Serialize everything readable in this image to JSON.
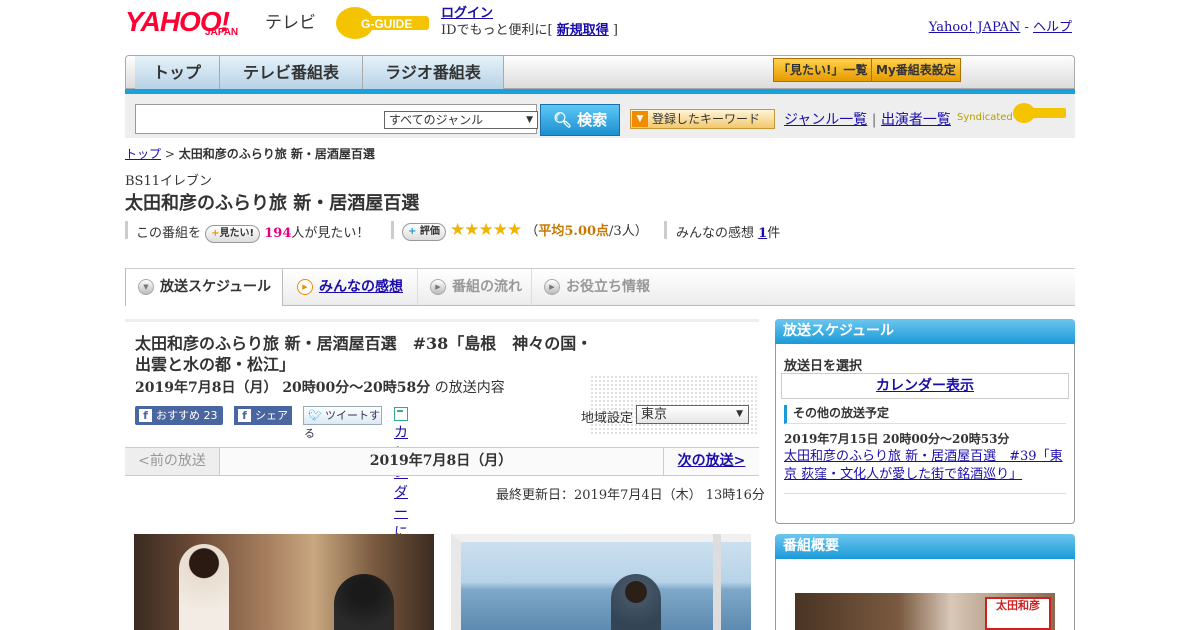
{
  "header": {
    "logo_yahoo": "YAHOO!",
    "logo_japan": "JAPAN",
    "logo_tv": "テレビ",
    "gguide_logo": "G-GUIDE",
    "login_link": "ログイン",
    "login_text": "IDでもっと便利に[ ",
    "signup_link": "新規取得",
    "login_text_end": " ]",
    "yahoo_japan_link": "Yahoo! JAPAN",
    "separator": " - ",
    "help_link": "ヘルプ"
  },
  "nav": {
    "tabs": [
      {
        "label": "トップ"
      },
      {
        "label": "テレビ番組表"
      },
      {
        "label": "ラジオ番組表"
      }
    ],
    "mitai_list": "「見たい!」一覧",
    "my_schedule": "My番組表設定"
  },
  "search": {
    "placeholder": "",
    "genre_selected": "すべてのジャンル",
    "button": "検索",
    "keyword_button": "登録したキーワード",
    "genre_list_link": "ジャンル一覧",
    "link_separator": "|",
    "cast_list_link": "出演者一覧",
    "syndicated": "Syndicated"
  },
  "breadcrumb": {
    "top": "トップ",
    "sep": " > ",
    "current": "太田和彦のふらり旅 新・居酒屋百選"
  },
  "program": {
    "channel": "BS11イレブン",
    "title": "太田和彦のふらり旅 新・居酒屋百選",
    "this_program": "この番組を",
    "mitai_pill": "見たい!",
    "mitai_count": "194",
    "mitai_suffix": "人が見たい！",
    "rating_pill": "評価",
    "stars": "★★★★★",
    "rating_open": "（",
    "rating_avg": "平均5.00点",
    "rating_count": "/3人）",
    "impressions_label": "みんなの感想",
    "impressions_count": "1",
    "impressions_suffix": "件"
  },
  "subtabs": [
    {
      "label": "放送スケジュール"
    },
    {
      "label": "みんなの感想"
    },
    {
      "label": "番組の流れ"
    },
    {
      "label": "お役立ち情報"
    }
  ],
  "episode": {
    "title": "太田和彦のふらり旅 新・居酒屋百選　#38「島根　神々の国・出雲と水の都・松江」",
    "datetime": "2019年7月8日（月） 20時00分～20時58分",
    "datetime_suffix": " の放送内容",
    "recommend": "おすすめ 23",
    "share": "シェア",
    "tweet": "ツイートする",
    "calendar_register": "カレンダーに登録",
    "region_label": "地域設定",
    "region_value": "東京",
    "prev": "<前の放送",
    "current_date": "2019年7月8日（月）",
    "next": "次の放送>",
    "updated": "最終更新日：2019年7月4日（木） 13時16分"
  },
  "sidebar": {
    "schedule_head": "放送スケジュール",
    "select_date": "放送日を選択",
    "calendar_display": "カレンダー表示",
    "other_head": "その他の放送予定",
    "other_date": "2019年7月15日 20時00分～20時53分",
    "other_link": "太田和彦のふらり旅 新・居酒屋百選　#39「東京 荻窪・文化人が愛した街で銘酒巡り」",
    "overview_head": "番組概要",
    "overview_card": "太田和彦"
  }
}
